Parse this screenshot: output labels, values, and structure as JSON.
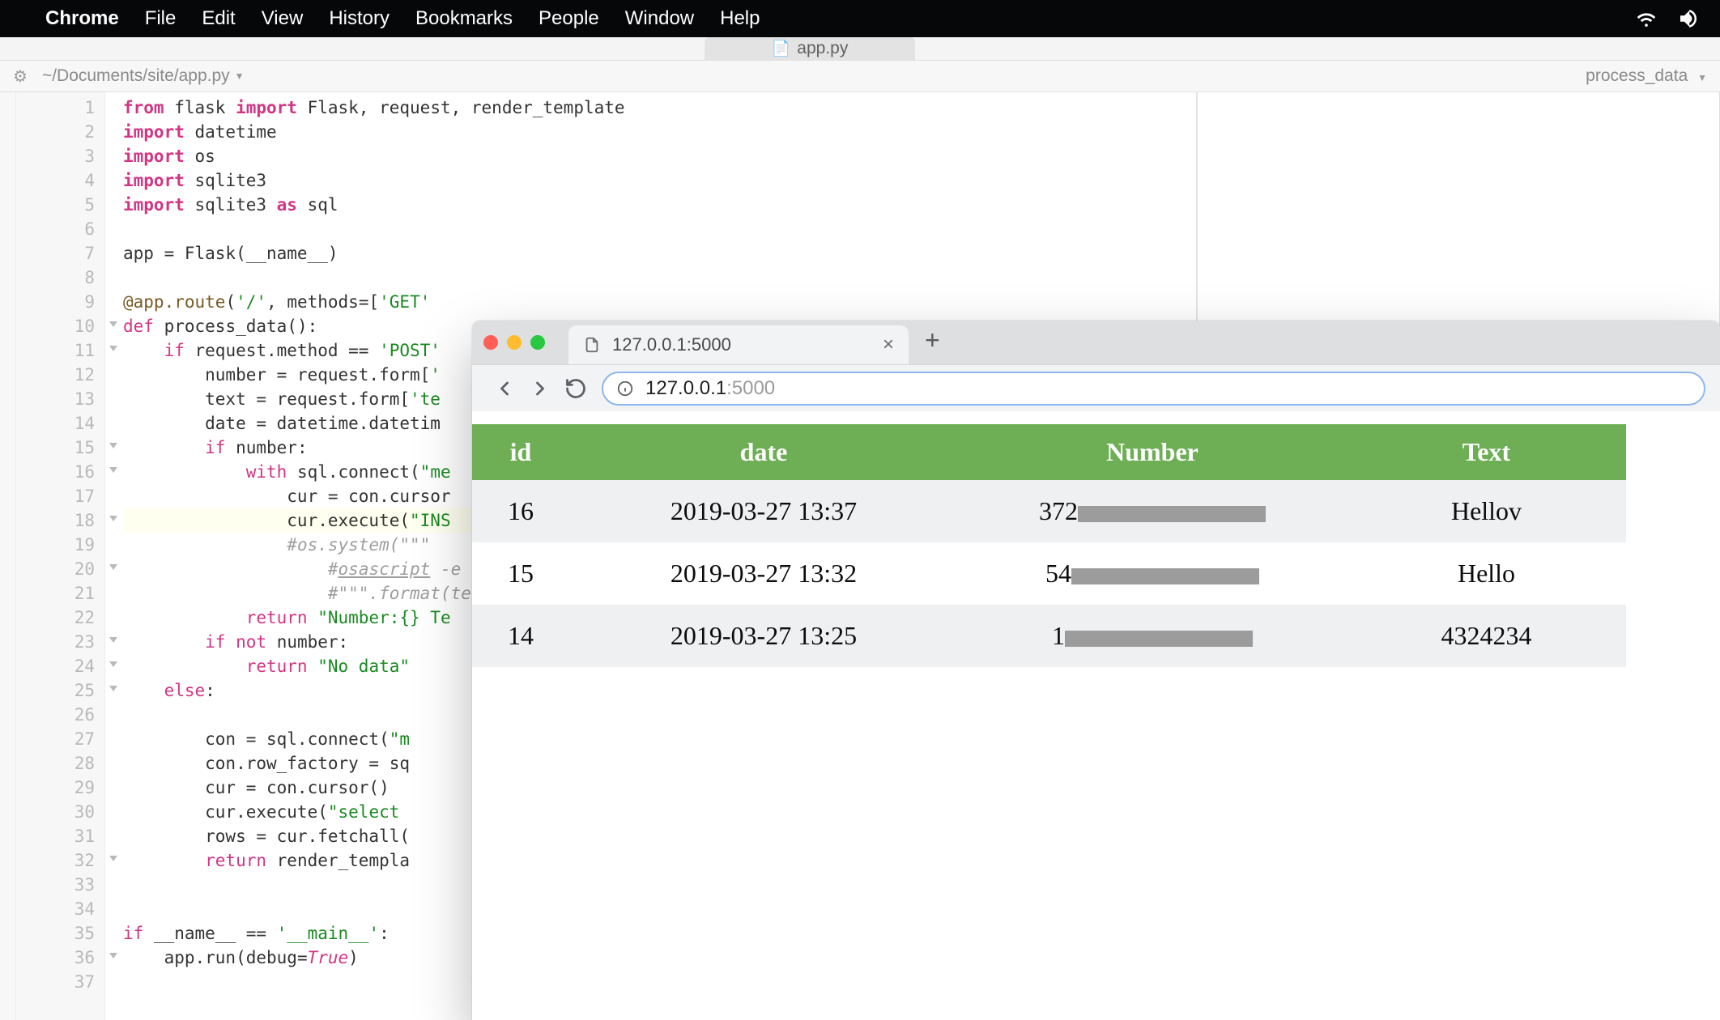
{
  "menubar": {
    "app": "Chrome",
    "items": [
      "File",
      "Edit",
      "View",
      "History",
      "Bookmarks",
      "People",
      "Window",
      "Help"
    ]
  },
  "editor": {
    "tabTitle": "app.py",
    "breadcrumb": "~/Documents/site/app.py",
    "rightStatus": "process_data",
    "lineCount": 37,
    "foldLines": [
      10,
      11,
      15,
      16,
      18,
      20,
      23,
      24,
      25,
      32,
      36
    ],
    "highlightLine": 18,
    "code": [
      {
        "n": 1,
        "html": "<span class='kw-import'>from</span> flask <span class='kw-import'>import</span> Flask, request, render_template"
      },
      {
        "n": 2,
        "html": "<span class='kw-import'>import</span> datetime"
      },
      {
        "n": 3,
        "html": "<span class='kw-import'>import</span> os"
      },
      {
        "n": 4,
        "html": "<span class='kw-import'>import</span> sqlite3"
      },
      {
        "n": 5,
        "html": "<span class='kw-import'>import</span> sqlite3 <span class='kw-import'>as</span> sql"
      },
      {
        "n": 6,
        "html": ""
      },
      {
        "n": 7,
        "html": "app = Flask(__name__)"
      },
      {
        "n": 8,
        "html": ""
      },
      {
        "n": 9,
        "html": "<span class='decor'>@app.route</span>(<span class='str'>'/'</span>, <span class='fn'>methods</span>=[<span class='str'>'GET'</span>"
      },
      {
        "n": 10,
        "html": "<span class='kw'>def</span> <span class='fn'>process_data</span>():"
      },
      {
        "n": 11,
        "html": "    <span class='kw'>if</span> request.method == <span class='str'>'POST'</span>"
      },
      {
        "n": 12,
        "html": "        number = request.form[<span class='str'>'</span>"
      },
      {
        "n": 13,
        "html": "        text = request.form[<span class='str'>'te</span>"
      },
      {
        "n": 14,
        "html": "        date = datetime.datetim"
      },
      {
        "n": 15,
        "html": "        <span class='kw'>if</span> number:"
      },
      {
        "n": 16,
        "html": "            <span class='kw'>with</span> sql.connect(<span class='str'>\"me</span>"
      },
      {
        "n": 17,
        "html": "                cur = con.cursor"
      },
      {
        "n": 18,
        "html": "                cur.execute(<span class='str'>\"INS</span>"
      },
      {
        "n": 19,
        "html": "                <span class='cmt'>#os.system(\"\"\"</span>"
      },
      {
        "n": 20,
        "html": "                    <span class='cmt'>#<span class='underline'>osascript</span> -e</span>"
      },
      {
        "n": 21,
        "html": "                    <span class='cmt'>#\"\"\".format(te</span>"
      },
      {
        "n": 22,
        "html": "            <span class='kw'>return</span> <span class='str'>\"Number:{} Te</span>"
      },
      {
        "n": 23,
        "html": "        <span class='kw'>if</span> <span class='kw'>not</span> number:"
      },
      {
        "n": 24,
        "html": "            <span class='kw'>return</span> <span class='str'>\"No data\"</span>"
      },
      {
        "n": 25,
        "html": "    <span class='kw'>else</span>:"
      },
      {
        "n": 26,
        "html": ""
      },
      {
        "n": 27,
        "html": "        con = sql.connect(<span class='str'>\"m</span>"
      },
      {
        "n": 28,
        "html": "        con.row_factory = sq"
      },
      {
        "n": 29,
        "html": "        cur = con.cursor()"
      },
      {
        "n": 30,
        "html": "        cur.execute(<span class='str'>\"select </span>"
      },
      {
        "n": 31,
        "html": "        rows = cur.fetchall("
      },
      {
        "n": 32,
        "html": "        <span class='kw'>return</span> render_templa"
      },
      {
        "n": 33,
        "html": ""
      },
      {
        "n": 34,
        "html": ""
      },
      {
        "n": 35,
        "html": "<span class='kw'>if</span> __name__ == <span class='str'>'__main__'</span>:"
      },
      {
        "n": 36,
        "html": "    app.run(<span class='fn'>debug</span>=<span class='bool'>True</span>)"
      },
      {
        "n": 37,
        "html": ""
      }
    ]
  },
  "chrome": {
    "tabTitle": "127.0.0.1:5000",
    "urlPrimary": "127.0.0.1",
    "urlSecondary": ":5000"
  },
  "table": {
    "headers": [
      "id",
      "date",
      "Number",
      "Text"
    ],
    "rows": [
      {
        "id": "16",
        "date": "2019-03-27 13:37",
        "numberPrefix": "372",
        "redactW": 232,
        "text": "Hellov"
      },
      {
        "id": "15",
        "date": "2019-03-27 13:32",
        "numberPrefix": "54",
        "redactW": 232,
        "text": "Hello"
      },
      {
        "id": "14",
        "date": "2019-03-27 13:25",
        "numberPrefix": "1",
        "redactW": 232,
        "text": "4324234"
      }
    ]
  }
}
